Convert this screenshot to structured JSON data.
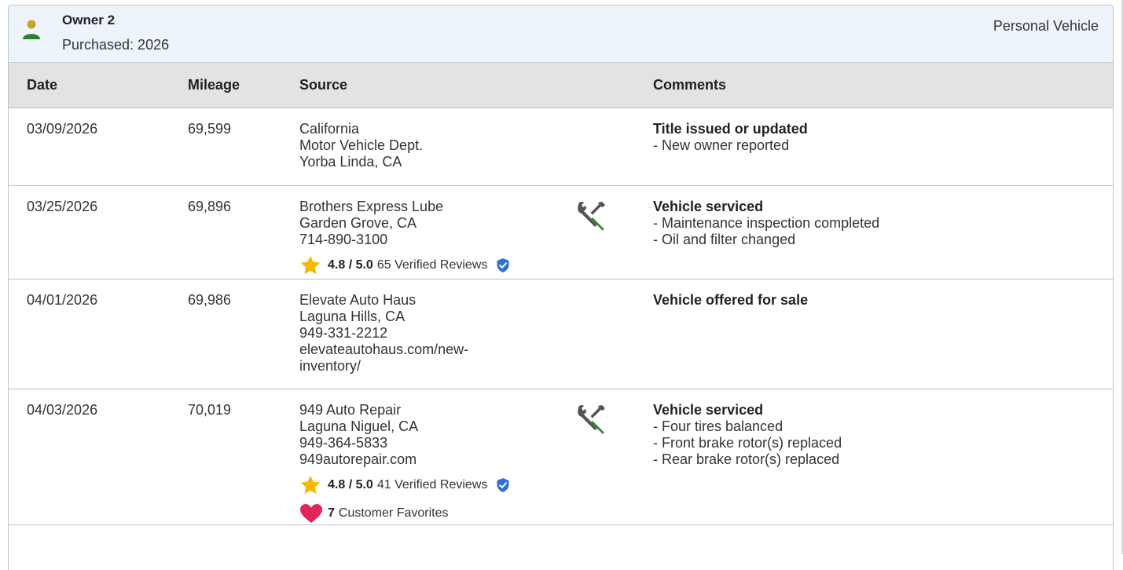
{
  "owner": {
    "title": "Owner 2",
    "purchased": "Purchased: 2026",
    "vehicle_type": "Personal Vehicle",
    "icon": "person-icon",
    "icon_colors": {
      "head": "#c9a227",
      "body": "#2e7d32"
    }
  },
  "table": {
    "headers": {
      "date": "Date",
      "mileage": "Mileage",
      "source": "Source",
      "comments": "Comments"
    },
    "rows": [
      {
        "date": "03/09/2026",
        "mileage": "69,599",
        "source_lines": [
          "California",
          "Motor Vehicle Dept.",
          "Yorba Linda, CA"
        ],
        "comment_title": "Title issued or updated",
        "comment_lines": [
          "- New owner reported"
        ]
      },
      {
        "date": "03/25/2026",
        "mileage": "69,896",
        "source_lines": [
          "Brothers Express Lube",
          "Garden Grove, CA",
          "714-890-3100"
        ],
        "rating": {
          "score": "4.8 / 5.0",
          "reviews": "65 Verified Reviews"
        },
        "service_icon": "wrench-screwdriver-icon",
        "comment_title": "Vehicle serviced",
        "comment_lines": [
          "- Maintenance inspection completed",
          "- Oil and filter changed"
        ]
      },
      {
        "date": "04/01/2026",
        "mileage": "69,986",
        "source_lines": [
          "Elevate Auto Haus",
          "Laguna Hills, CA",
          "949-331-2212",
          "elevateautohaus.com/new-",
          "inventory/"
        ],
        "comment_title": "Vehicle offered for sale",
        "comment_lines": []
      },
      {
        "date": "04/03/2026",
        "mileage": "70,019",
        "source_lines": [
          "949 Auto Repair",
          "Laguna Niguel, CA",
          "949-364-5833",
          "949autorepair.com"
        ],
        "rating": {
          "score": "4.8 / 5.0",
          "reviews": "41 Verified Reviews"
        },
        "favorites": {
          "count": "7",
          "label": "Customer Favorites"
        },
        "service_icon": "wrench-screwdriver-icon",
        "comment_title": "Vehicle serviced",
        "comment_lines": [
          "- Four tires balanced",
          "- Front brake rotor(s) replaced",
          "- Rear brake rotor(s) replaced"
        ]
      }
    ]
  },
  "colors": {
    "header_bg": "#eef4fb",
    "table_header_bg": "#e3e3e3",
    "star": "#f5b800",
    "heart": "#e0245e",
    "shield": "#2f6fd6",
    "service_icon_tool": "#555555",
    "service_icon_handle": "#2e8b3a"
  }
}
